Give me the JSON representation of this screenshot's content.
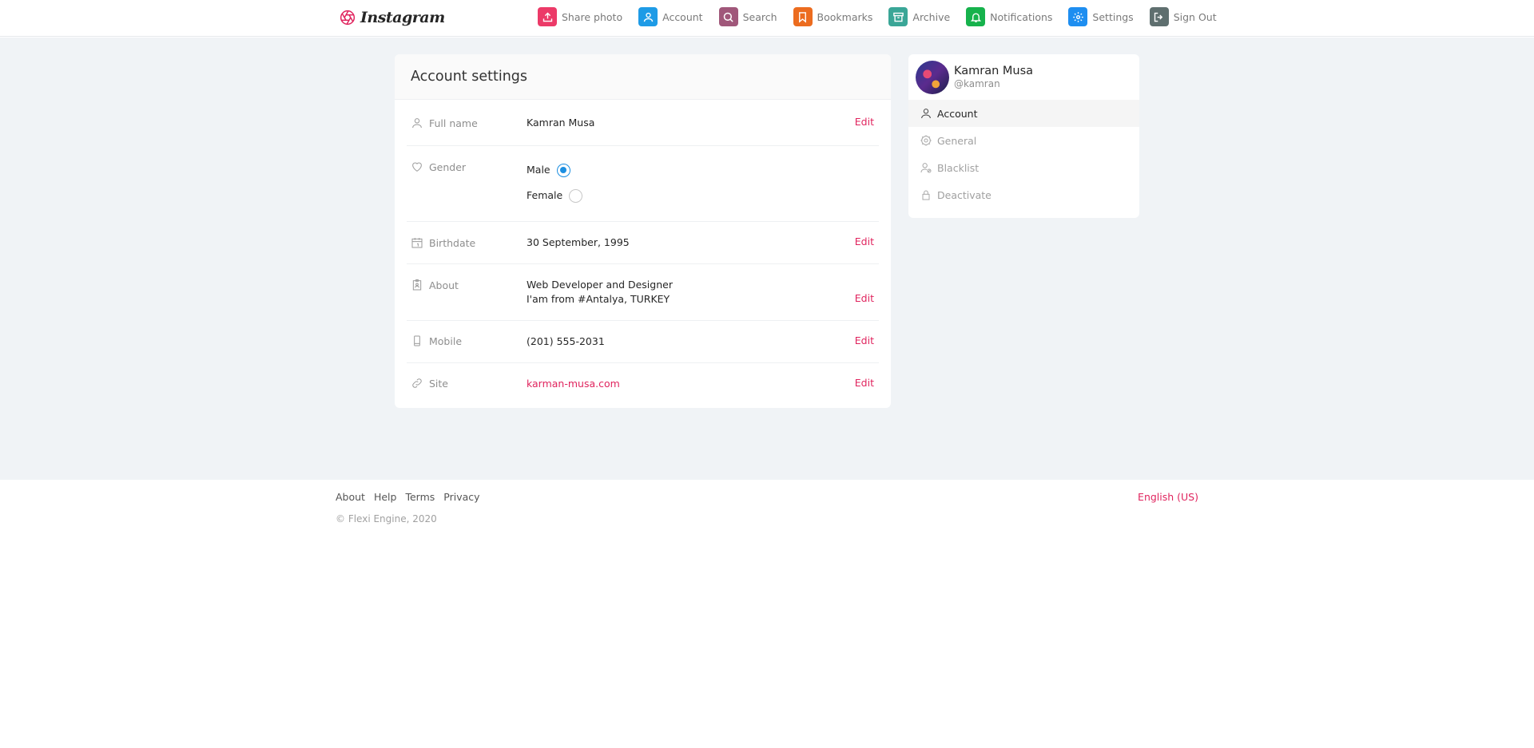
{
  "brand": {
    "name": "Instagram"
  },
  "nav": [
    {
      "label": "Share photo",
      "icon": "upload-icon",
      "color": "#ec3a68"
    },
    {
      "label": "Account",
      "icon": "user-icon",
      "color": "#1e9be6"
    },
    {
      "label": "Search",
      "icon": "search-icon",
      "color": "#a0577a"
    },
    {
      "label": "Bookmarks",
      "icon": "bookmark-icon",
      "color": "#ec6c1f"
    },
    {
      "label": "Archive",
      "icon": "archive-icon",
      "color": "#3aa697"
    },
    {
      "label": "Notifications",
      "icon": "bell-icon",
      "color": "#16b24c"
    },
    {
      "label": "Settings",
      "icon": "gear-icon",
      "color": "#1e8ef0"
    },
    {
      "label": "Sign Out",
      "icon": "sign-out-icon",
      "color": "#5f6f6f"
    }
  ],
  "settings": {
    "title": "Account settings",
    "edit_label": "Edit",
    "full_name": {
      "label": "Full name",
      "value": "Kamran Musa"
    },
    "gender": {
      "label": "Gender",
      "options": [
        "Male",
        "Female"
      ],
      "selected": "Male"
    },
    "birthdate": {
      "label": "Birthdate",
      "value": "30 September, 1995"
    },
    "about": {
      "label": "About",
      "lines": [
        "Web Developer and Designer",
        "I'am from #Antalya, TURKEY"
      ]
    },
    "mobile": {
      "label": "Mobile",
      "value": "(201) 555-2031"
    },
    "site": {
      "label": "Site",
      "value": "karman-musa.com"
    }
  },
  "profile": {
    "name": "Kamran Musa",
    "handle": "@kamran"
  },
  "side_menu": [
    {
      "label": "Account",
      "icon": "user-icon",
      "active": true
    },
    {
      "label": "General",
      "icon": "gear-icon",
      "active": false
    },
    {
      "label": "Blacklist",
      "icon": "user-block-icon",
      "active": false
    },
    {
      "label": "Deactivate",
      "icon": "lock-icon",
      "active": false
    }
  ],
  "footer": {
    "links": [
      "About",
      "Help",
      "Terms",
      "Privacy"
    ],
    "copyright": "© Flexi Engine, 2020",
    "language": "English (US)"
  },
  "colors": {
    "accent": "#e0245e",
    "radio": "#1d8fe1",
    "background": "#f0f3f6"
  }
}
